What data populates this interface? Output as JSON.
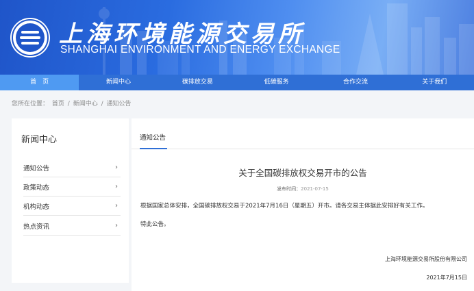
{
  "header": {
    "org_name_cn": "上海环境能源交易所",
    "org_name_en": "SHANGHAI ENVIRONMENT AND ENERGY EXCHANGE"
  },
  "nav": {
    "items": [
      {
        "label": "首　页",
        "active": true
      },
      {
        "label": "新闻中心",
        "active": false
      },
      {
        "label": "碳排放交易",
        "active": false
      },
      {
        "label": "低碳服务",
        "active": false
      },
      {
        "label": "合作交流",
        "active": false
      },
      {
        "label": "关于我们",
        "active": false
      }
    ]
  },
  "breadcrumb": {
    "prefix": "您所在位置：",
    "items": [
      "首页",
      "新闻中心",
      "通知公告"
    ],
    "separator": "/"
  },
  "sidebar": {
    "title": "新闻中心",
    "items": [
      {
        "label": "通知公告"
      },
      {
        "label": "政策动态"
      },
      {
        "label": "机构动态"
      },
      {
        "label": "热点资讯"
      }
    ],
    "chevron": "›"
  },
  "main": {
    "tab_label": "通知公告",
    "article_title": "关于全国碳排放权交易开市的公告",
    "publish_label": "发布时间：",
    "publish_date": "2021-07-15",
    "paragraph_1": "根据国家总体安排，全国碳排放权交易于2021年7月16日（星期五）开市。请各交易主体据此安排好有关工作。",
    "paragraph_2": "特此公告。",
    "organization": "上海环境能源交易所股份有限公司",
    "sign_date": "2021年7月15日"
  },
  "colors": {
    "nav_bg": "#2f6fd6",
    "nav_active": "#4f9af2",
    "page_bg": "#f3f5f8"
  }
}
